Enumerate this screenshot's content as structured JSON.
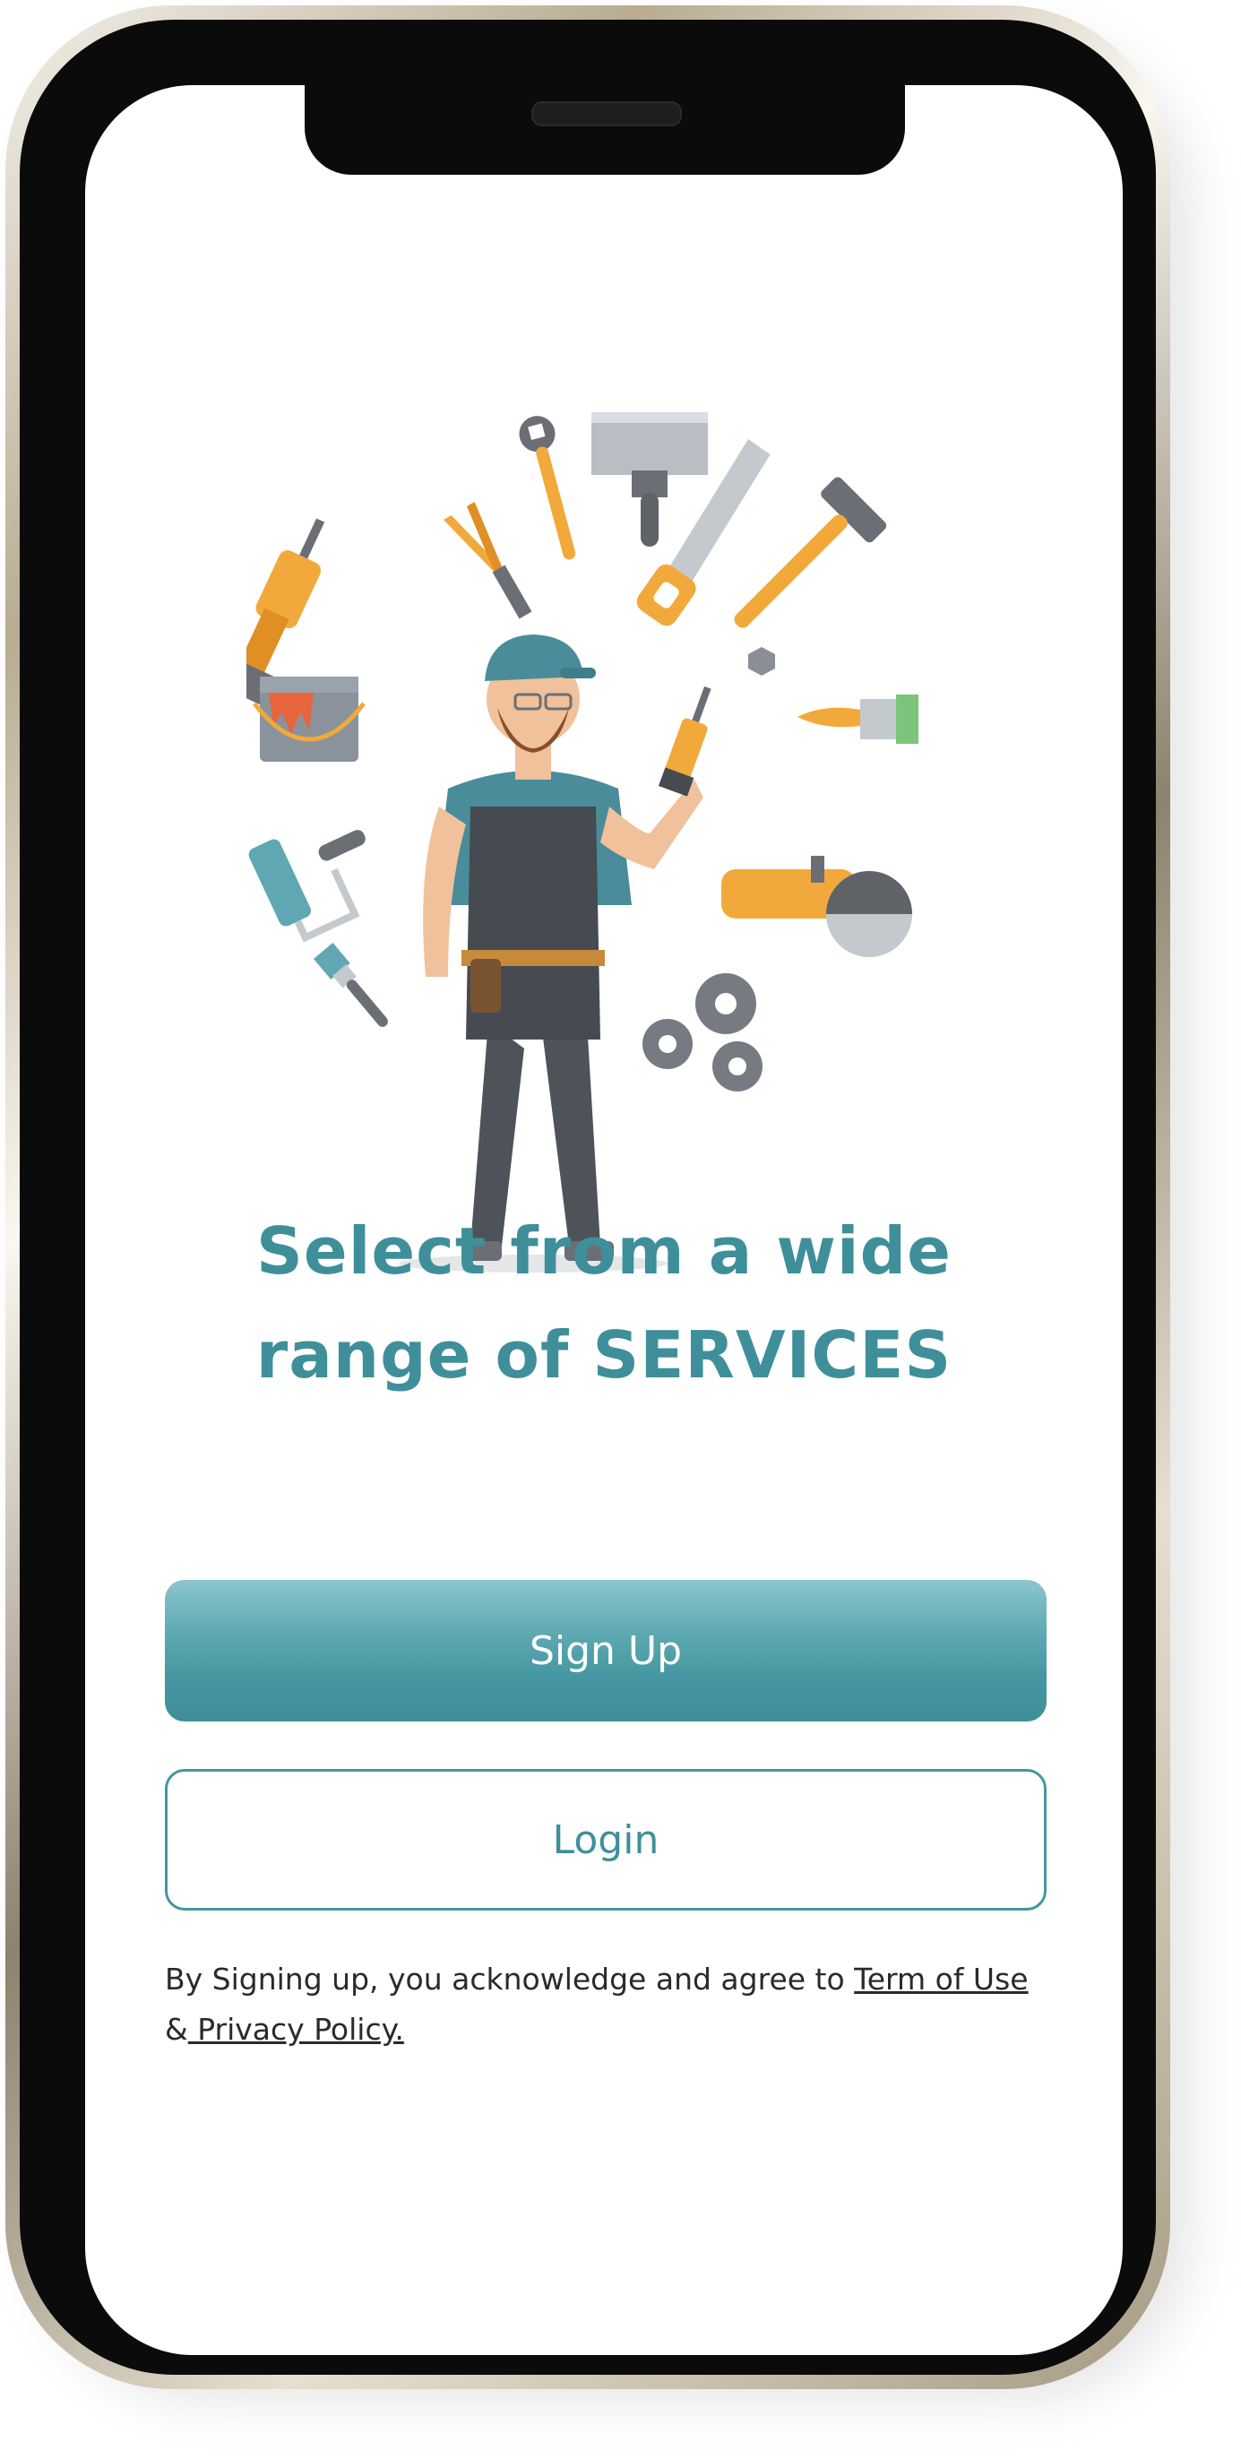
{
  "screen": {
    "headline_line1": "Select from a wide",
    "headline_line2": "range of SERVICES",
    "signup_label": "Sign Up",
    "login_label": "Login",
    "legal_text": "By Signing up, you acknowledge and agree to ",
    "terms_link": "Term of Use",
    "legal_amp": "&",
    "privacy_link": " Privacy Policy."
  },
  "colors": {
    "accent": "#4596a0",
    "headline": "#3f8f9a",
    "button_text": "#ffffff",
    "body_text": "#2a2a2a"
  },
  "icons": {
    "illustration": "handyman-with-tools-illustration",
    "tools": [
      "drill-icon",
      "pliers-icon",
      "wrench-icon",
      "putty-knife-icon",
      "saw-icon",
      "hammer-icon",
      "paint-bucket-icon",
      "paint-brush-icon",
      "paint-roller-icon",
      "angle-grinder-icon",
      "gears-icon",
      "nut-icon"
    ]
  }
}
